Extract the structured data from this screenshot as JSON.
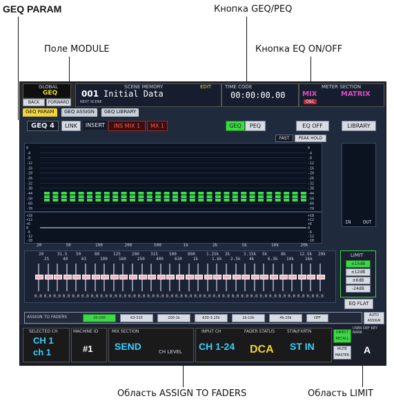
{
  "callouts": {
    "geq_param": "GEQ PARAM",
    "geq_peq_button": "Кнопка GEQ/PEQ",
    "module_field": "Поле MODULE",
    "eq_onoff_button": "Кнопка EQ ON/OFF",
    "assign_to_faders_area": "Область ASSIGN TO FADERS",
    "limit_area": "Область LIMIT"
  },
  "topbar": {
    "global_label": "GLOBAL",
    "geq_label": "GEQ",
    "back_label": "BACK",
    "forward_label": "FORWARD",
    "scene_memory_label": "SCENE MEMORY",
    "edit_label": "EDIT",
    "scene_number": "001",
    "scene_name": "Initial Data",
    "next_scene_label": "NEXT SCENE",
    "timecode_label": "TIME CODE",
    "timecode": "00:00:00.00",
    "meter_section_label": "METER SECTION",
    "mix_label": "MIX",
    "matrix_label": "MATRIX",
    "osc_label": "OSC"
  },
  "tabs": [
    "GEQ PARAM",
    "GEQ ASSIGN",
    "GEQ LIBRARY"
  ],
  "controls": {
    "module": "GEQ 4",
    "link": "LINK",
    "insert": "INSERT",
    "ins_mix": "INS MIX 1",
    "mx": "MX 1",
    "geq": "GEQ",
    "peq": "PEQ",
    "eq_off": "EQ OFF",
    "library": "LIBRARY",
    "fast": "FAST",
    "peak_hold": "PEAK HOLD",
    "in": "IN",
    "out": "OUT",
    "eq_flat": "EQ FLAT",
    "limit_title": "LIMIT",
    "limit_options": [
      "±15dB",
      "±12dB",
      "±6dB",
      "-24dB"
    ]
  },
  "analyzer": {
    "y_ticks": [
      "0",
      "-4",
      "-8",
      "-12",
      "-16",
      "-20",
      "-26",
      "-32",
      "-38",
      "-44",
      "-50",
      "-60",
      "-70"
    ],
    "x_ticks": [
      "20",
      "50",
      "100",
      "200",
      "500",
      "1k",
      "2k",
      "5k",
      "10k",
      "20k"
    ],
    "resp_ticks": [
      "+18",
      "+12",
      "+6",
      "0",
      "-6",
      "-12",
      "-18"
    ]
  },
  "fader_freqs_top": [
    "20",
    "31.5",
    "50",
    "80",
    "125",
    "200",
    "315",
    "500",
    "800",
    "1.25k",
    "2k",
    "3.15k",
    "5k",
    "8k",
    "12.5k",
    "20k"
  ],
  "fader_freqs_bottom": [
    "25",
    "40",
    "63",
    "100",
    "160",
    "250",
    "400",
    "630",
    "1k",
    "1.6k",
    "2.5k",
    "4k",
    "6.3k",
    "10k",
    "16k"
  ],
  "fader_values": "0.0",
  "assign": {
    "label": "ASSIGN TO FADERS",
    "ranges": [
      "20-100",
      "63-315",
      "200-1k",
      "630-3.15k",
      "2k-10k",
      "4k-20k"
    ],
    "off": "OFF",
    "auto_assign": "AUTO ASSIGN"
  },
  "bottom": {
    "selected_ch_label": "SELECTED CH",
    "ch_line1": "CH 1",
    "ch_line2": "ch 1",
    "machine_id_label": "MACHINE ID",
    "machine_id": "#1",
    "mix_section_label": "MIX SECTION",
    "send": "SEND",
    "ch_level": "CH LEVEL",
    "input_ch_label": "INPUT CH",
    "input_ch": "CH 1-24",
    "fader_status_label": "FADER STATUS",
    "dca": "DCA",
    "stin_label": "STIN/FXRTN",
    "st_in": "ST IN",
    "direct_recall": "DIRECT RECALL",
    "mute_master": "MUTE MASTER",
    "user_def": "USER DEF KEY BANK",
    "bank": "A"
  }
}
